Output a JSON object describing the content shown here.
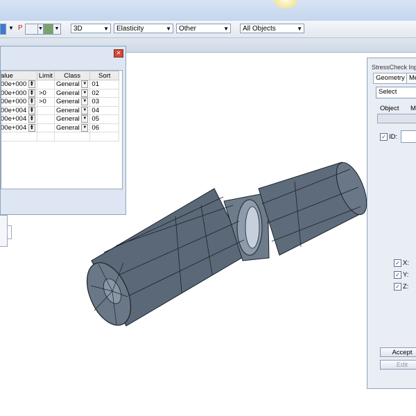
{
  "toolbar": {
    "p_label": "P",
    "combo_view": "3D",
    "combo_material": "Elasticity",
    "combo_other": "Other",
    "combo_objects": "All Objects"
  },
  "left_dialog": {
    "columns": [
      "alue",
      "Limit",
      "Class",
      "Sort"
    ],
    "rows": [
      {
        "value": "00e+000",
        "limit": "",
        "class": "General",
        "sort": "01"
      },
      {
        "value": "00e+000",
        "limit": ">0",
        "class": "General",
        "sort": "02"
      },
      {
        "value": "00e+000",
        "limit": ">0",
        "class": "General",
        "sort": "03"
      },
      {
        "value": "00e+004",
        "limit": "",
        "class": "General",
        "sort": "04"
      },
      {
        "value": "00e+004",
        "limit": "",
        "class": "General",
        "sort": "05"
      },
      {
        "value": "00e+004",
        "limit": "",
        "class": "General",
        "sort": "06"
      }
    ]
  },
  "right_panel": {
    "title": "StressCheck Input",
    "tabs": [
      "Geometry",
      "Me"
    ],
    "select_label": "Select",
    "object_label": "Object",
    "m_label": "M",
    "id_label": "ID:",
    "x_label": "X:",
    "y_label": "Y:",
    "z_label": "Z:",
    "accept_label": "Accept",
    "edit_label": "Edit"
  },
  "colors": {
    "model_fill": "#5b6877",
    "model_edge": "#1b222b",
    "window_frame": "#dde6f2"
  }
}
